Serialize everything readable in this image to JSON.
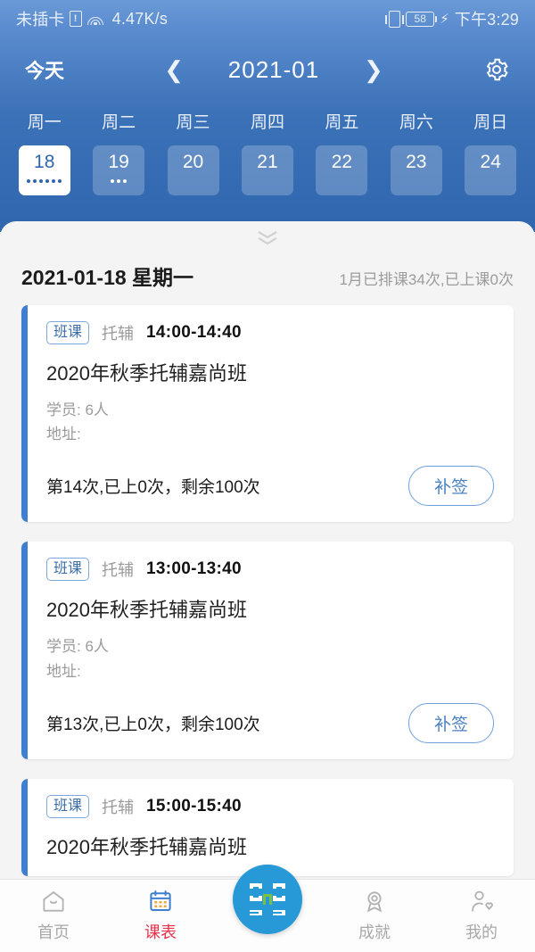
{
  "statusbar": {
    "carrier": "未插卡",
    "sim_icon": "sim-card-alert-icon",
    "wifi_icon": "wifi-icon",
    "network_speed": "4.47K/s",
    "vibrate_icon": "vibrate-icon",
    "battery_level": "58",
    "charging_icon": "charging-bolt-icon",
    "time": "下午3:29"
  },
  "toolbar": {
    "today_label": "今天",
    "prev_icon": "chevron-left-icon",
    "next_icon": "chevron-right-icon",
    "month_label": "2021-01",
    "settings_icon": "gear-icon"
  },
  "calendar": {
    "weekdays": [
      "周一",
      "周二",
      "周三",
      "周四",
      "周五",
      "周六",
      "周日"
    ],
    "days": [
      {
        "num": "18",
        "dots": 6,
        "selected": true
      },
      {
        "num": "19",
        "dots": 3,
        "selected": false
      },
      {
        "num": "20",
        "dots": 0,
        "selected": false
      },
      {
        "num": "21",
        "dots": 0,
        "selected": false
      },
      {
        "num": "22",
        "dots": 0,
        "selected": false
      },
      {
        "num": "23",
        "dots": 0,
        "selected": false
      },
      {
        "num": "24",
        "dots": 0,
        "selected": false
      }
    ],
    "expand_icon": "chevron-double-down-icon"
  },
  "daybar": {
    "date": "2021-01-18 星期一",
    "stat": "1月已排课34次,已上课0次"
  },
  "lessons": [
    {
      "badge": "班课",
      "type": "托辅",
      "time": "14:00-14:40",
      "title": "2020年秋季托辅嘉尚班",
      "students": "学员: 6人",
      "address": "地址:",
      "progress": "第14次,已上0次，剩余100次",
      "action": "补签"
    },
    {
      "badge": "班课",
      "type": "托辅",
      "time": "13:00-13:40",
      "title": "2020年秋季托辅嘉尚班",
      "students": "学员: 6人",
      "address": "地址:",
      "progress": "第13次,已上0次，剩余100次",
      "action": "补签"
    },
    {
      "badge": "班课",
      "type": "托辅",
      "time": "15:00-15:40",
      "title": "2020年秋季托辅嘉尚班",
      "students": "",
      "address": "",
      "progress": "",
      "action": ""
    }
  ],
  "tabbar": {
    "items": [
      {
        "label": "首页",
        "icon": "home-icon",
        "active": false
      },
      {
        "label": "课表",
        "icon": "calendar-icon",
        "active": true
      },
      {
        "label": "成就",
        "icon": "medal-icon",
        "active": false
      },
      {
        "label": "我的",
        "icon": "person-heart-icon",
        "active": false
      }
    ],
    "logo_icon": "app-logo-icon"
  },
  "colors": {
    "header_blue": "#3c72b8",
    "accent_blue": "#3f7fd0",
    "active_red": "#e8334a",
    "logo_blue": "#2699d6",
    "panel_bg": "#f4f4f4"
  }
}
